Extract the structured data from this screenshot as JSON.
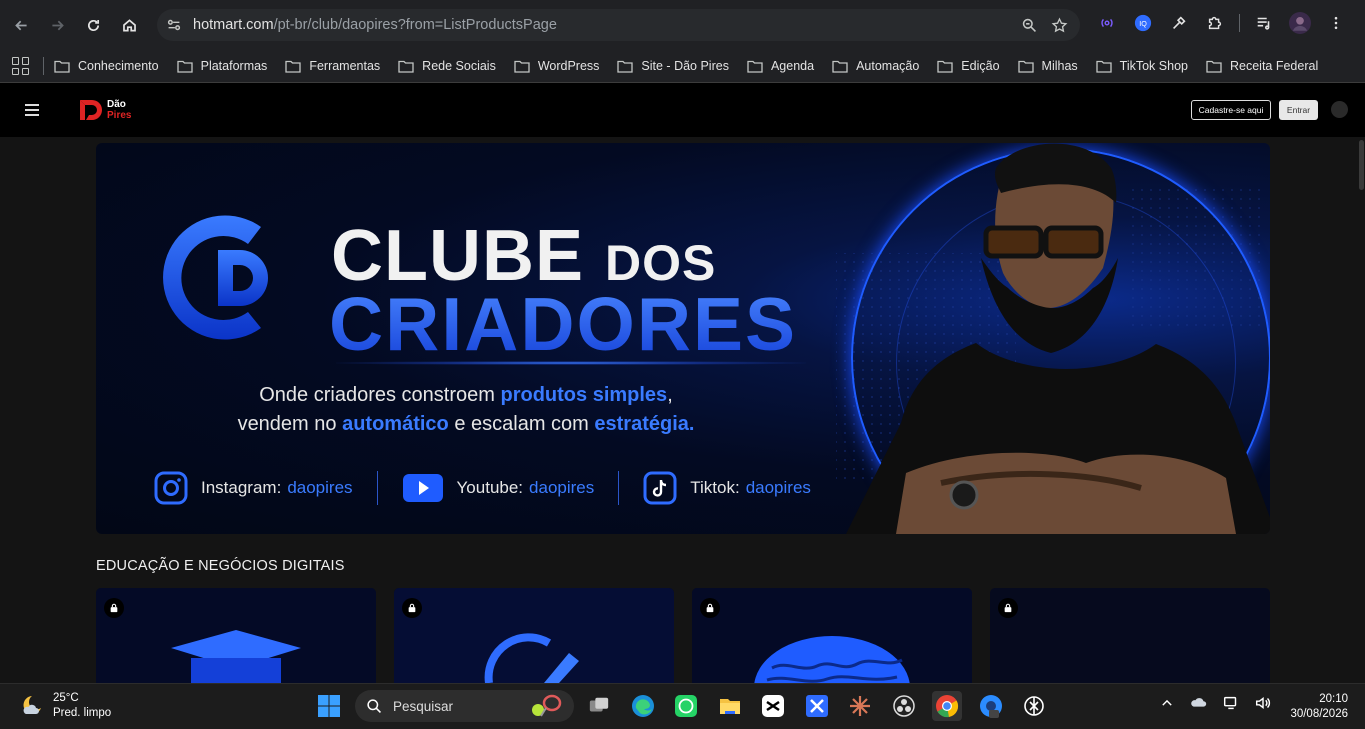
{
  "browser": {
    "url_host": "hotmart.com",
    "url_path": "/pt-br/club/daopires?from=ListProductsPage",
    "bookmarks": [
      "Conhecimento",
      "Plataformas",
      "Ferramentas",
      "Rede Sociais",
      "WordPress",
      "Site - Dão Pires",
      "Agenda",
      "Automação",
      "Edição",
      "Milhas",
      "TikTok Shop",
      "Receita Federal"
    ]
  },
  "header": {
    "logo_line1": "Dão",
    "logo_line2": "Pires",
    "signup_label": "Cadastre-se aqui",
    "login_label": "Entrar"
  },
  "banner": {
    "title_line1": "CLUBE",
    "title_dos": "DOS",
    "title_line2": "CRIADORES",
    "tagline_a": "Onde criadores constroem ",
    "tagline_b": "produtos simples",
    "tagline_c": ",",
    "tagline_d": "vendem no ",
    "tagline_e": "automático",
    "tagline_f": " e escalam com ",
    "tagline_g": "estratégia.",
    "instagram_label": "Instagram:",
    "instagram_handle": "daopires",
    "youtube_label": "Youtube:",
    "youtube_handle": "daopires",
    "tiktok_label": "Tiktok:",
    "tiktok_handle": "daopires"
  },
  "section": {
    "title": "EDUCAÇÃO E NEGÓCIOS DIGITAIS"
  },
  "taskbar": {
    "temperature": "25°C",
    "weather_desc": "Pred. limpo",
    "search_placeholder": "Pesquisar",
    "time": "20:10",
    "date": "30/08/2026"
  },
  "colors": {
    "accent_blue": "#2f6cff",
    "brand_red": "#e02424"
  }
}
